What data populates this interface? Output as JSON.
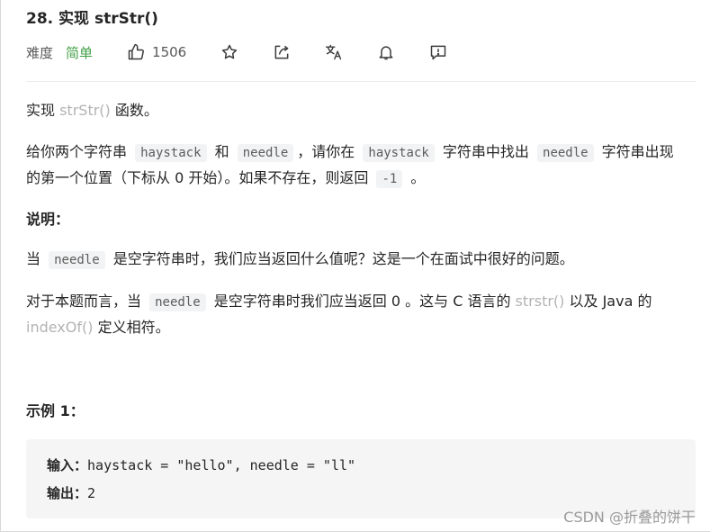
{
  "problem": {
    "title": "28. 实现 strStr()"
  },
  "meta": {
    "difficulty_label": "难度",
    "difficulty_value": "简单",
    "like_count": "1506",
    "icons": [
      "thumbs-up-icon",
      "star-icon",
      "share-icon",
      "translate-icon",
      "bell-icon",
      "feedback-icon"
    ],
    "colors": {
      "difficulty": "#43a047",
      "func_text": "#b3b3b3"
    }
  },
  "description": {
    "p1": {
      "a": "实现 ",
      "func": "strStr()",
      "b": " 函数。"
    },
    "p2": {
      "a": "给你两个字符串 ",
      "code1": "haystack",
      "b": " 和 ",
      "code2": "needle",
      "c": "，请你在 ",
      "code3": "haystack",
      "d": " 字符串中找出 ",
      "code4": "needle",
      "e": " 字符串出现的第一个位置（下标从 0 开始）。如果不存在，则返回 ",
      "code5": "-1",
      "f": " 。"
    },
    "note_heading": "说明：",
    "p3": {
      "a": "当 ",
      "code": "needle",
      "b": " 是空字符串时，我们应当返回什么值呢？这是一个在面试中很好的问题。"
    },
    "p4": {
      "a": "对于本题而言，当 ",
      "code": "needle",
      "b": " 是空字符串时我们应当返回 0 。这与 C 语言的 ",
      "func1": "strstr()",
      "c": " 以及 Java 的 ",
      "func2": "indexOf()",
      "d": " 定义相符。"
    }
  },
  "example": {
    "heading": "示例 1：",
    "input_label": "输入：",
    "input_value": "haystack = \"hello\", needle = \"ll\"",
    "output_label": "输出：",
    "output_value": "2"
  },
  "watermark": "CSDN @折叠的饼干"
}
